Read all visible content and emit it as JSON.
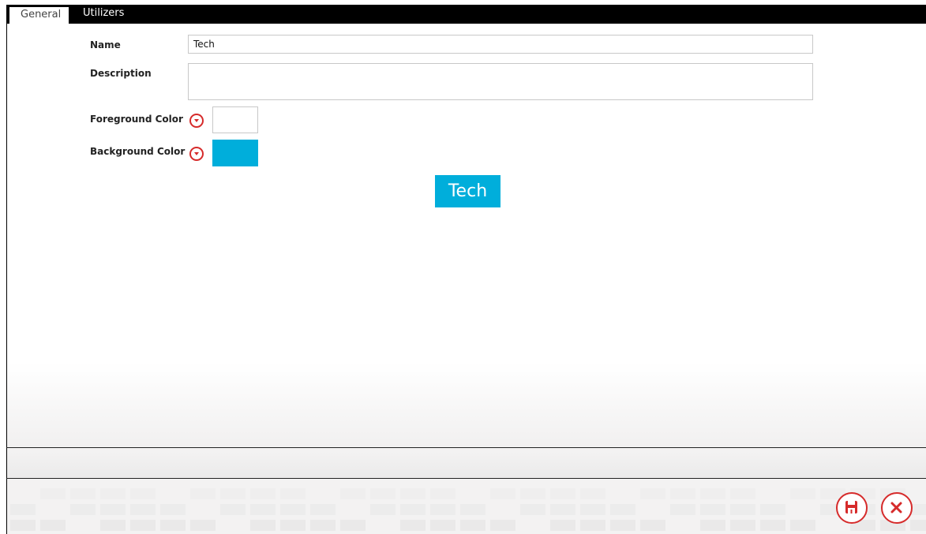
{
  "tabs": {
    "general": "General",
    "utilizers": "Utilizers"
  },
  "form": {
    "name_label": "Name",
    "name_value": "Tech",
    "description_label": "Description",
    "description_value": "",
    "foreground_label": "Foreground Color",
    "background_label": "Background Color"
  },
  "colors": {
    "foreground": "#ffffff",
    "background": "#00aedb",
    "accent": "#d62b2b"
  },
  "preview": {
    "text": "Tech"
  },
  "actions": {
    "save_icon": "save-icon",
    "cancel_icon": "close-icon"
  }
}
